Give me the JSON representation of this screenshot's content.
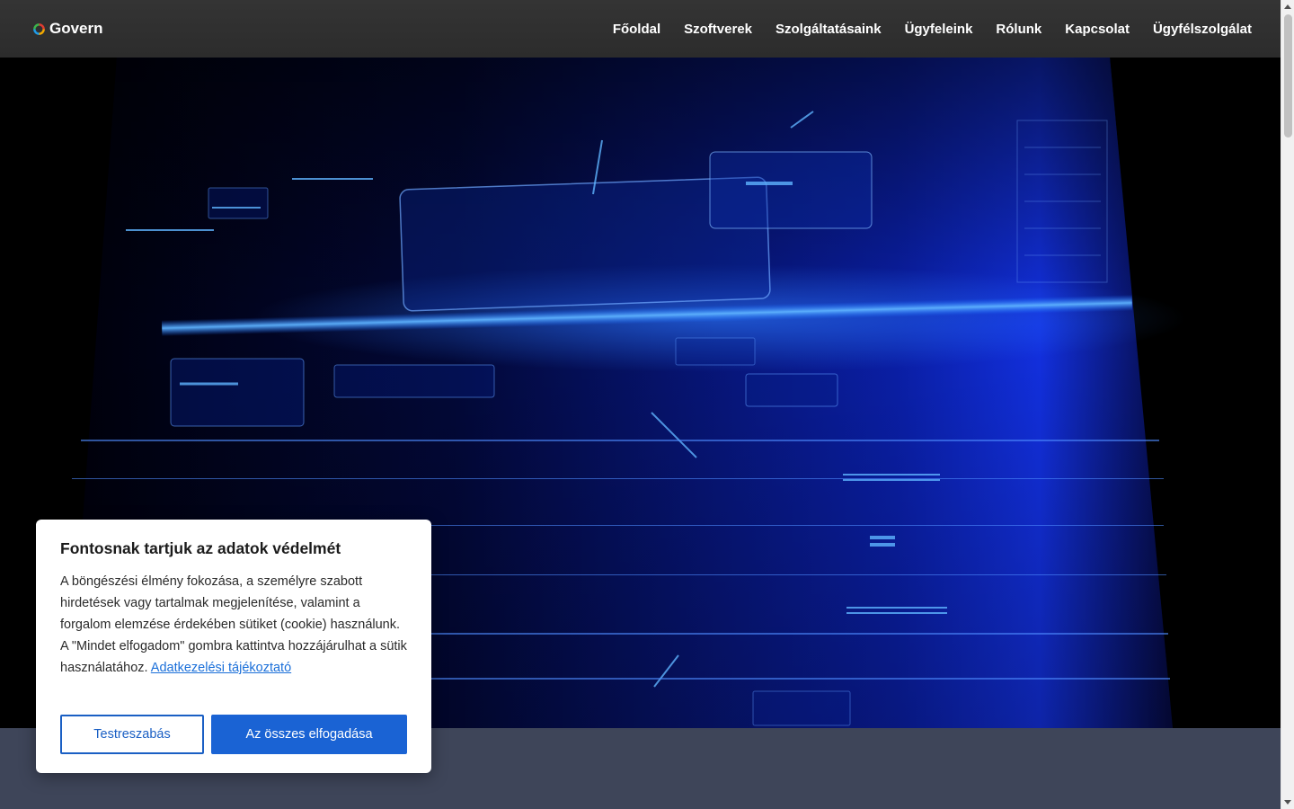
{
  "header": {
    "logo_text": "Govern",
    "logo_icon": "govern-logo-icon",
    "nav": [
      {
        "label": "Főoldal"
      },
      {
        "label": "Szoftverek"
      },
      {
        "label": "Szolgáltatásaink"
      },
      {
        "label": "Ügyfeleink"
      },
      {
        "label": "Rólunk"
      },
      {
        "label": "Kapcsolat"
      },
      {
        "label": "Ügyfélszolgálat"
      }
    ]
  },
  "hero": {
    "image": "digital-data-network-hero-image"
  },
  "cookie": {
    "title": "Fontosnak tartjuk az adatok védelmét",
    "text": "A böngészési élmény fokozása, a személyre szabott hirdetések vagy tartalmak megjelenítése, valamint a forgalom elemzése érdekében sütiket (cookie) használunk. A \"Mindet elfogadom\" gombra kattintva hozzájárulhat a sütik használatához.",
    "link_label": "Adatkezelési tájékoztató",
    "customize_label": "Testreszabás",
    "accept_label": "Az összes elfogadása"
  },
  "colors": {
    "header_bg": "#2c2c2c",
    "accent_blue": "#1a63d4",
    "band_bg": "#3e4559"
  }
}
